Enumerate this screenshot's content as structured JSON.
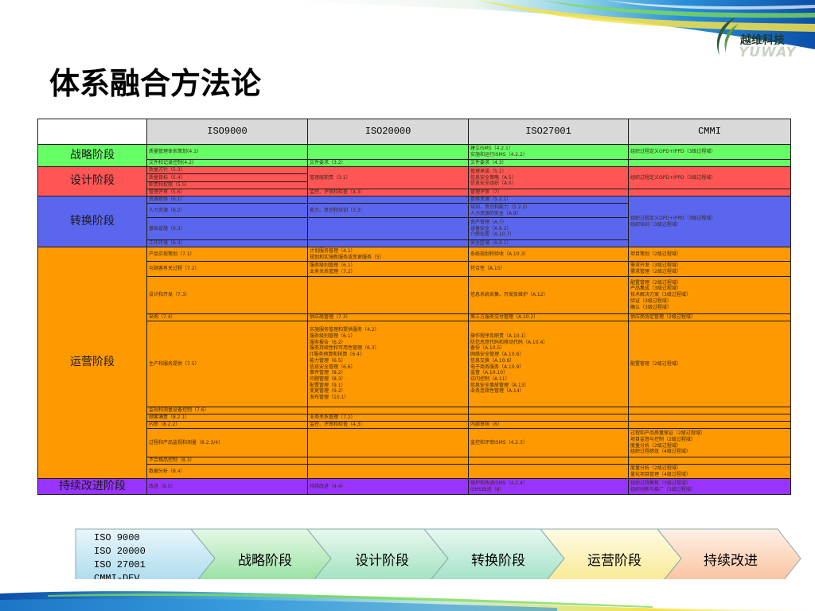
{
  "brand": {
    "name_cn": "越维科技",
    "name_en": "YUWAY"
  },
  "title": "体系融合方法论",
  "colors": {
    "strategy": "#66ff66",
    "design": "#ff5555",
    "transition": "#5b66ef",
    "operation": "#ff9900",
    "improvement": "#9933ff",
    "header": "#d9d9d9"
  },
  "table": {
    "headers": [
      "ISO9000",
      "ISO20000",
      "ISO27001",
      "CMMI"
    ],
    "strategy": {
      "phase": "战略阶段",
      "r1": {
        "iso9000": "质量管理体系策划(4.1)",
        "iso20000": "",
        "iso27001": [
          "建立ISMS（4.2.1）",
          "实施和运行ISMS（4.2.2）"
        ],
        "cmmi": "组织过程定义OPD+IPPD（3级过程域）"
      },
      "r2": {
        "iso9000": "文件和记录控制(4.2)",
        "iso20000": "文件要求（3.2）",
        "iso27001": "文件要求（4.3）",
        "cmmi": ""
      }
    },
    "design": {
      "phase": "设计阶段",
      "r1": {
        "iso9000": "质量方针（5.3）",
        "iso20000": "管理层职责（3.1）",
        "iso27001": [
          "管理承诺（5.1）",
          "信息安全策略（A.5）",
          "信息安全组织（A.6）"
        ],
        "cmmi": "组织过程定义OPD+IPPD（3级过程域）"
      },
      "r2": {
        "iso9000": "质量目标（5.4）"
      },
      "r3": {
        "iso9000": "职责和权限（5.5）"
      },
      "r4": {
        "iso9000": "管理评审（5.6）",
        "iso20000": "监控、评审和检查（4.3）",
        "iso27001": "管理评审（7）"
      }
    },
    "transition": {
      "phase": "转换阶段",
      "r1": {
        "iso9000": "资源提供（6.1）",
        "iso20000": "",
        "iso27001": "提供资源（5.2.1）",
        "cmmi": [
          "组织过程定义OPD+IPPD（3级过程域）",
          "组织培训（3级过程域）"
        ]
      },
      "r2": {
        "iso9000": "人力资源（6.2）",
        "iso20000": "能力、意识和培训（3.3）",
        "iso27001": [
          "培训、意识和能力（5.2.2）",
          "人力资源的安全（A.8）"
        ]
      },
      "r3": {
        "iso9000": "基础设施（6.3）",
        "iso20000": "",
        "iso27001": [
          "资产管理（A.7）",
          "设备安全（A.9.2）",
          "介质处置（A.10.7）"
        ]
      },
      "r4": {
        "iso9000": "工作环境（6.4）",
        "iso20000": "",
        "iso27001": "安全区域（A.9.1）"
      }
    },
    "operation": {
      "phase": "运营阶段",
      "rows": [
        {
          "iso9000": "产品实现策划（7.1）",
          "iso20000": [
            "计划服务管理（4.1）",
            "规划和实施新服务或变更服务（5）"
          ],
          "iso27001": "系统规划和验收（A.10.3）",
          "cmmi": "项目策划（2级过程域）"
        },
        {
          "iso9000": "与顾客有关过程（7.2）",
          "iso20000": [
            "服务级别管理（6.1）",
            "业务关系管理（7.2）"
          ],
          "iso27001": "符合性（A.15）",
          "cmmi": [
            "需求开发（3级过程域）",
            "需求管理（2级过程域）"
          ]
        },
        {
          "iso9000": "设计和开发（7.3）",
          "iso20000": "",
          "iso27001": "信息系统采集、开发及维护（A.12）",
          "cmmi": [
            "配置管理（2级过程域）",
            "产品集成（3级过程域）",
            "技术解决方案（3级过程域）",
            "验证（3级过程域）",
            "确认（3级过程域）"
          ]
        },
        {
          "iso9000": "采购（7.4）",
          "iso20000": "供应商管理（7.3）",
          "iso27001": "第三方服务交付管理（A.10.2）",
          "cmmi": "供应商协定管理（2级过程域）"
        },
        {
          "iso9000": "生产和服务提供（7.5）",
          "iso20000": [
            "实施服务管理和提供服务（4.2）",
            "服务级别管理（6.1）",
            "服务报告（6.2）",
            "服务持续性和可用性管理（6.3）",
            "IT服务预算和核算（6.4）",
            "能力管理（6.5）",
            "信息安全管理（6.6）",
            "事件管理（8.2）",
            "问题管理（8.3）",
            "配置管理（9.1）",
            "变更管理（9.2）",
            "发布管理（10.1）"
          ],
          "iso27001": [
            "操作程序及职责（A.10.1）",
            "防范恶意代码和移动代码（A.10.4）",
            "备份（A.10.5）",
            "网络安全管理（A.10.6）",
            "信息交换（A.10.8）",
            "电子商务服务（A.10.9）",
            "监督（A.10.10）",
            "访问控制（A.11）",
            "信息安全事故管理（A.13）",
            "业务连续性管理（A.14）"
          ],
          "cmmi": "配置管理（2级过程域）"
        },
        {
          "iso9000": "监视和测量设备控制（7.6）",
          "iso20000": "",
          "iso27001": "",
          "cmmi": ""
        },
        {
          "iso9000": "顾客满意（8.2.1）",
          "iso20000": "业务关系管理（7.2）",
          "iso27001": "",
          "cmmi": ""
        },
        {
          "iso9000": "内审（8.2.2）",
          "iso20000": "监控、评审和检查（4.3）",
          "iso27001": "内部审核（6）",
          "cmmi": ""
        },
        {
          "iso9000": "过程和产品监视和测量（8.2.3/4）",
          "iso20000": "",
          "iso27001": "监控和评审ISMS（4.2.3）",
          "cmmi": [
            "过程和产品质量保证（2级过程域）",
            "项目监督与控制（2级过程域）",
            "度量分析（2级过程域）",
            "组织过程绩效（4级过程域）"
          ]
        },
        {
          "iso9000": "不合格品控制（8.3）",
          "iso20000": "",
          "iso27001": "",
          "cmmi": ""
        },
        {
          "iso9000": "数据分析（8.4）",
          "iso20000": "",
          "iso27001": "",
          "cmmi": [
            "度量分析（2级过程域）",
            "量化项目管理（4级过程域）"
          ]
        }
      ]
    },
    "improvement": {
      "phase": "持续改进阶段",
      "row": {
        "iso9000": "改进（8.5）",
        "iso20000": "持续改进（4.4）",
        "iso27001": [
          "维护和改进ISMS（4.2.4）",
          "ISMS改进（8）"
        ],
        "cmmi": [
          "组织过程聚焦（3级过程域）",
          "组织创新与推广（5级过程域）"
        ]
      }
    }
  },
  "flow": {
    "standards": [
      "ISO 9000",
      "ISO 20000",
      "ISO 27001",
      "CMMI-DEV"
    ],
    "steps": [
      "战略阶段",
      "设计阶段",
      "转换阶段",
      "运营阶段",
      "持续改进"
    ]
  }
}
